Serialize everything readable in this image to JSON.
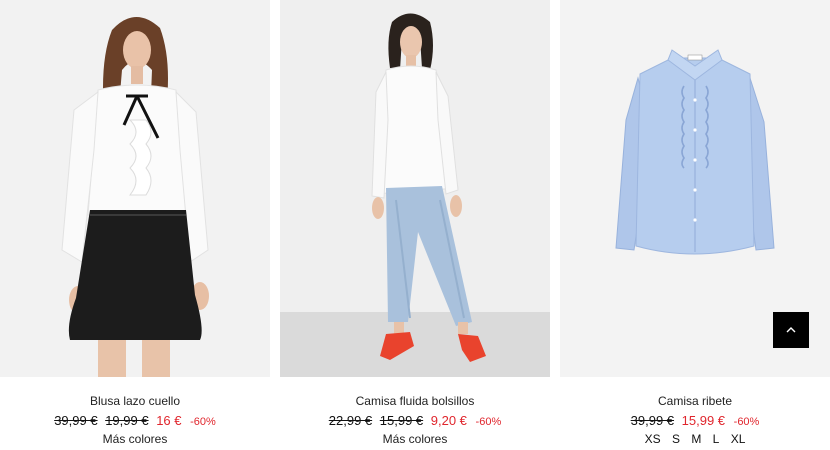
{
  "products": [
    {
      "name": "Blusa lazo cuello",
      "prices": [
        "39,99 €",
        "19,99 €"
      ],
      "sale_price": "16 €",
      "discount": "-60%",
      "more_colors": "Más colores"
    },
    {
      "name": "Camisa fluida bolsillos",
      "prices": [
        "22,99 €",
        "15,99 €"
      ],
      "sale_price": "9,20 €",
      "discount": "-60%",
      "more_colors": "Más colores"
    },
    {
      "name": "Camisa ribete",
      "prices": [
        "39,99 €"
      ],
      "sale_price": "15,99 €",
      "discount": "-60%",
      "sizes": [
        "XS",
        "S",
        "M",
        "L",
        "XL"
      ]
    }
  ],
  "back_to_top_icon": "chevron-up-icon",
  "colors": {
    "sale": "#e0262d",
    "back_to_top_bg": "#000000",
    "shirt_blue": "#b6cdee"
  }
}
